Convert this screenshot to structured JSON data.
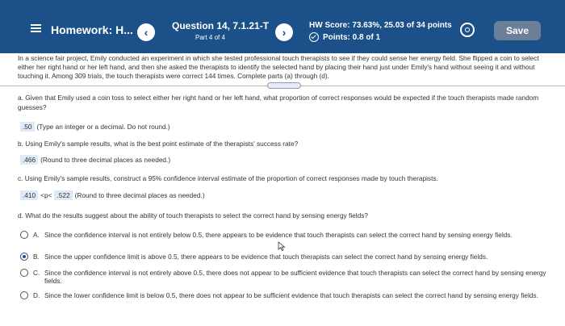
{
  "header": {
    "homework_title": "Homework: H...",
    "question_title": "Question 14, 7.1.21-T",
    "part_label": "Part 4 of 4",
    "hw_score": "HW Score: 73.63%, 25.03 of 34 points",
    "points": "Points: 0.8 of 1",
    "save_label": "Save",
    "prev_glyph": "‹",
    "next_glyph": "›"
  },
  "intro": "In a science fair project, Emily conducted an experiment in which she tested professional touch therapists to see if they could sense her energy field. She flipped a coin to select either her right hand or her left hand, and then she asked the therapists to identify the selected hand by placing their hand just under Emily's hand without seeing it and without touching it. Among 309 trials, the touch therapists were correct 144 times. Complete parts (a) through (d).",
  "part_a": {
    "question": "a. Given that Emily used a coin toss to select either her right hand or her left hand, what proportion of correct responses would be expected if the touch therapists made random guesses?",
    "answer": ".50",
    "hint": "(Type an integer or a decimal. Do not round.)"
  },
  "part_b": {
    "question": "b. Using Emily's sample results, what is the best point estimate of the therapists' success rate?",
    "answer": ".466",
    "hint": "(Round to three decimal places as needed.)"
  },
  "part_c": {
    "question": "c. Using Emily's sample results, construct a 95% confidence interval estimate of the proportion of correct responses made by touch therapists.",
    "lower": ".410",
    "relation": "<p<",
    "upper": ".522",
    "hint": "(Round to three decimal places as needed.)"
  },
  "part_d": {
    "question": "d. What do the results suggest about the ability of touch therapists to select the correct hand by sensing energy fields?",
    "options": [
      {
        "letter": "A.",
        "text": "Since the confidence interval is not entirely below 0.5, there appears to be evidence that touch therapists can select the correct hand by sensing energy fields."
      },
      {
        "letter": "B.",
        "text": "Since the upper confidence limit is above 0.5, there appears to be evidence that touch therapists can select the correct hand by sensing energy fields."
      },
      {
        "letter": "C.",
        "text": "Since the confidence interval is not entirely above 0.5, there does not appear to be sufficient evidence that touch therapists can select the correct hand by sensing energy fields."
      },
      {
        "letter": "D.",
        "text": "Since the lower confidence limit is below 0.5, there does not appear to be sufficient evidence that touch therapists can select the correct hand by sensing energy fields."
      }
    ],
    "selected": "B."
  },
  "colors": {
    "header_bg": "#1b5088",
    "save_bg": "#6b7f99",
    "answer_highlight": "#dfe9f7"
  },
  "icons": [
    "menu-icon",
    "prev-icon",
    "next-icon",
    "check-circle-icon",
    "gear-icon",
    "cursor-icon"
  ]
}
